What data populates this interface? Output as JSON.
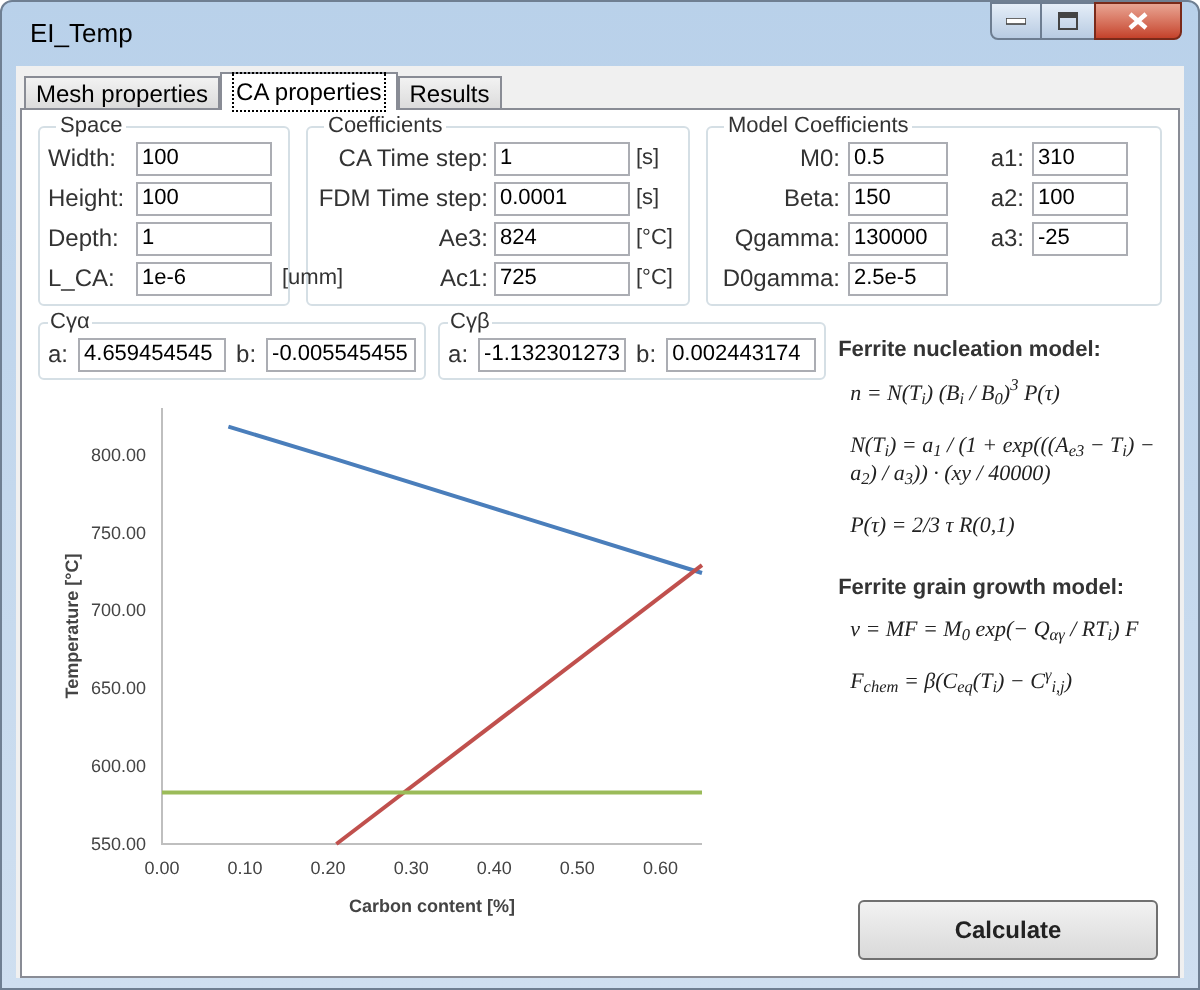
{
  "window": {
    "title": "EI_Temp"
  },
  "tabs": [
    {
      "label": "Mesh properties",
      "selected": false
    },
    {
      "label": "CA properties",
      "selected": true
    },
    {
      "label": "Results",
      "selected": false
    }
  ],
  "space": {
    "title": "Space",
    "fields": [
      {
        "label": "Width:",
        "value": "100"
      },
      {
        "label": "Height:",
        "value": "100"
      },
      {
        "label": "Depth:",
        "value": "1"
      },
      {
        "label": "L_CA:",
        "value": "1e-6",
        "unit": "[umm]"
      }
    ]
  },
  "coefficients": {
    "title": "Coefficients",
    "fields": [
      {
        "label": "CA Time step:",
        "value": "1",
        "unit": "[s]"
      },
      {
        "label": "FDM Time step:",
        "value": "0.0001",
        "unit": "[s]"
      },
      {
        "label": "Ae3:",
        "value": "824",
        "unit": "[°C]"
      },
      {
        "label": "Ac1:",
        "value": "725",
        "unit": "[°C]"
      }
    ]
  },
  "model_coefficients": {
    "title": "Model Coefficients",
    "fields": [
      {
        "label": "M0:",
        "value": "0.5"
      },
      {
        "label": "a1:",
        "value": "310"
      },
      {
        "label": "Beta:",
        "value": "150"
      },
      {
        "label": "a2:",
        "value": "100"
      },
      {
        "label": "Qgamma:",
        "value": "130000"
      },
      {
        "label": "a3:",
        "value": "-25"
      },
      {
        "label": "D0gamma:",
        "value": "2.5e-5"
      }
    ]
  },
  "c_groups": [
    {
      "title": "Cγα",
      "a_label": "a:",
      "a": "4.659454545",
      "b_label": "b:",
      "b": "-0.005545455"
    },
    {
      "title": "Cγβ",
      "a_label": "a:",
      "a": "-1.132301273",
      "b_label": "b:",
      "b": "0.002443174"
    }
  ],
  "chart_data": {
    "type": "line",
    "xlabel": "Carbon content [%]",
    "ylabel": "Temperature [°C]",
    "x": [
      0,
      0.08,
      0.21,
      0.65
    ],
    "series": [
      {
        "color": "#4a7ebb",
        "values": [
          null,
          818,
          797,
          724
        ]
      },
      {
        "color": "#c0504d",
        "values": [
          null,
          null,
          550,
          729
        ]
      },
      {
        "color": "#9bbb59",
        "values": [
          583,
          583,
          583,
          583
        ]
      }
    ],
    "xlim": [
      0,
      0.65
    ],
    "ylim": [
      550,
      830
    ],
    "xticks": [
      {
        "value": 0,
        "label": "0.00"
      },
      {
        "value": 0.1,
        "label": "0.10"
      },
      {
        "value": 0.2,
        "label": "0.20"
      },
      {
        "value": 0.3,
        "label": "0.30"
      },
      {
        "value": 0.4,
        "label": "0.40"
      },
      {
        "value": 0.5,
        "label": "0.50"
      },
      {
        "value": 0.6,
        "label": "0.60"
      }
    ],
    "yticks": [
      {
        "value": 550,
        "label": "550.00"
      },
      {
        "value": 600,
        "label": "600.00"
      },
      {
        "value": 650,
        "label": "650.00"
      },
      {
        "value": 700,
        "label": "700.00"
      },
      {
        "value": 750,
        "label": "750.00"
      },
      {
        "value": 800,
        "label": "800.00"
      }
    ]
  },
  "nucleation": {
    "title": "Ferrite nucleation model:",
    "formulas": [
      "n = N(T$_{i}$) (B$_{i}$ / B$_{0}$)$^{3}$ P(τ)",
      "N(T$_{i}$) = a$_{1}$ / (1 + exp(((A$_{e3}$ − T$_{i}$) − a$_{2}$) / a$_{3}$)) · (xy / 40000)",
      "P(τ) = 2/3 τ R(0,1)"
    ]
  },
  "growth": {
    "title": "Ferrite grain growth model:",
    "formulas": [
      "v = MF = M$_{0}$ exp(− Q$_{αγ}$ / RT$_{i}$) F",
      "F$_{chem}$ = β(C$_{eq}$(T$_{i}$) − C$^{γ}$$_{i,j}$)"
    ]
  },
  "calculate_button": "Calculate"
}
